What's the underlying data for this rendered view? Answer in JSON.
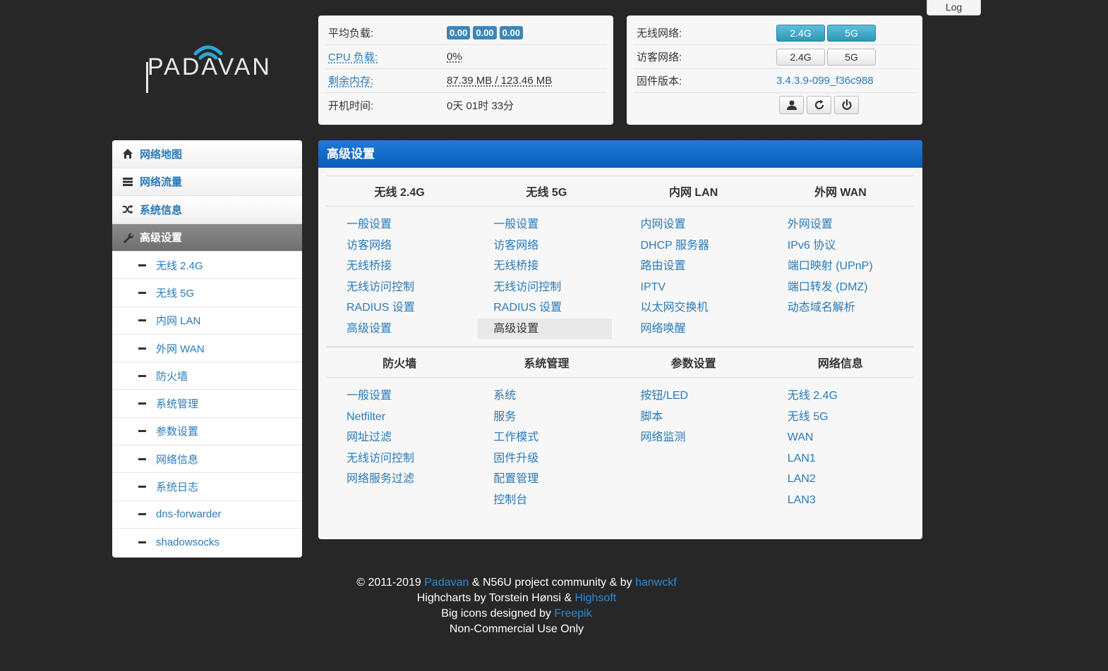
{
  "log_tab": "Log",
  "logo_text": "PADAVAN",
  "status": {
    "load_label": "平均负载:",
    "load_values": [
      "0.00",
      "0.00",
      "0.00"
    ],
    "cpu_label": "CPU 负载:",
    "cpu_value": "0%",
    "mem_label": "剩余内存:",
    "mem_value": "87.39 MB / 123.46 MB",
    "uptime_label": "开机时间:",
    "uptime_value": "0天 01时 33分"
  },
  "wifi": {
    "wireless_label": "无线网络:",
    "guest_label": "访客网络:",
    "btn_24": "2.4G",
    "btn_5": "5G",
    "firmware_label": "固件版本:",
    "firmware_value": "3.4.3.9-099_f36c988"
  },
  "sidebar": {
    "items": [
      "网络地图",
      "网络流量",
      "系统信息",
      "高级设置"
    ],
    "subitems": [
      "无线 2.4G",
      "无线 5G",
      "内网 LAN",
      "外网 WAN",
      "防火墙",
      "系统管理",
      "参数设置",
      "网络信息",
      "系统日志",
      "dns-forwarder",
      "shadowsocks"
    ]
  },
  "main": {
    "title": "高级设置",
    "sections_top": [
      "无线 2.4G",
      "无线 5G",
      "内网 LAN",
      "外网 WAN"
    ],
    "links_top": [
      [
        "一般设置",
        "访客网络",
        "无线桥接",
        "无线访问控制",
        "RADIUS 设置",
        "高级设置"
      ],
      [
        "一般设置",
        "访客网络",
        "无线桥接",
        "无线访问控制",
        "RADIUS 设置",
        "高级设置"
      ],
      [
        "内网设置",
        "DHCP 服务器",
        "路由设置",
        "IPTV",
        "以太网交换机",
        "网络唤醒"
      ],
      [
        "外网设置",
        "IPv6 协议",
        "端口映射 (UPnP)",
        "端口转发 (DMZ)",
        "动态域名解析"
      ]
    ],
    "sections_bottom": [
      "防火墙",
      "系统管理",
      "参数设置",
      "网络信息"
    ],
    "links_bottom": [
      [
        "一般设置",
        "Netfilter",
        "网址过滤",
        "无线访问控制",
        "网络服务过滤"
      ],
      [
        "系统",
        "服务",
        "工作模式",
        "固件升级",
        "配置管理",
        "控制台"
      ],
      [
        "按钮/LED",
        "脚本",
        "网络监测"
      ],
      [
        "无线 2.4G",
        "无线 5G",
        "WAN",
        "LAN1",
        "LAN2",
        "LAN3"
      ]
    ]
  },
  "footer": {
    "l1_a": "© 2011-2019 ",
    "l1_link1": "Padavan",
    "l1_b": " & N56U project community & by ",
    "l1_link2": "hanwckf",
    "l2_a": "Highcharts by Torstein Hønsi & ",
    "l2_link": "Highsoft",
    "l3_a": "Big icons designed by ",
    "l3_link": "Freepik",
    "l4": "Non-Commercial Use Only"
  }
}
